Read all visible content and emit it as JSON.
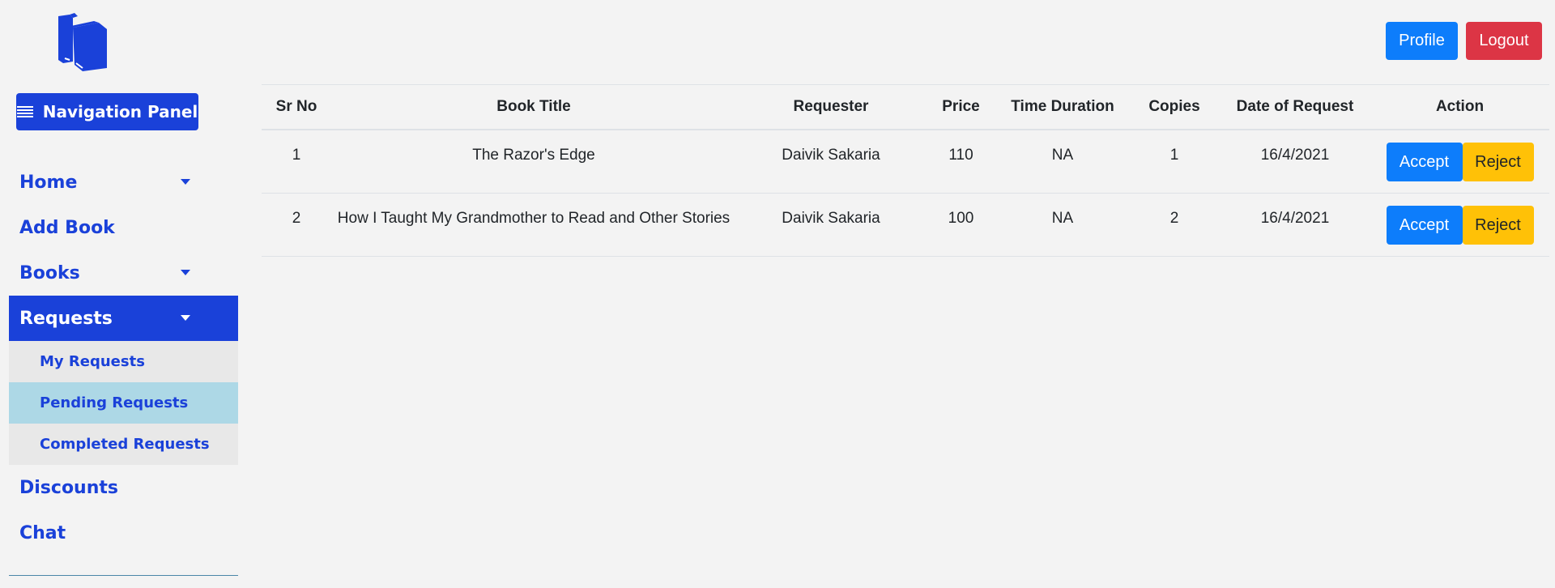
{
  "sidebar": {
    "nav_panel_label": "Navigation Panel",
    "items": [
      {
        "label": "Home"
      },
      {
        "label": "Add Book"
      },
      {
        "label": "Books"
      },
      {
        "label": "Requests"
      },
      {
        "label": "Discounts"
      },
      {
        "label": "Chat"
      }
    ],
    "sub_items": [
      {
        "label": "My Requests"
      },
      {
        "label": "Pending Requests"
      },
      {
        "label": "Completed Requests"
      }
    ],
    "active_item": "Requests",
    "current_sub_item": "Pending Requests"
  },
  "header": {
    "profile_label": "Profile",
    "logout_label": "Logout"
  },
  "table": {
    "columns": [
      "Sr No",
      "Book Title",
      "Requester",
      "Price",
      "Time Duration",
      "Copies",
      "Date of Request",
      "Action"
    ],
    "rows": [
      {
        "sr_no": "1",
        "title": "The Razor's Edge",
        "requester": "Daivik Sakaria",
        "price": "110",
        "duration": "NA",
        "copies": "1",
        "date": "16/4/2021",
        "accept": "Accept",
        "reject": "Reject"
      },
      {
        "sr_no": "2",
        "title": "How I Taught My Grandmother to Read and Other Stories",
        "requester": "Daivik Sakaria",
        "price": "100",
        "duration": "NA",
        "copies": "2",
        "date": "16/4/2021",
        "accept": "Accept",
        "reject": "Reject"
      }
    ]
  },
  "colors": {
    "primary": "#1a41d9",
    "accept": "#0d7dfb",
    "logout": "#dc3545",
    "reject": "#ffc107",
    "current_sub_bg": "#add8e6"
  },
  "icons": {
    "logo": "books-icon",
    "nav_panel": "menu-bars-icon",
    "dropdown": "caret-down-icon"
  }
}
